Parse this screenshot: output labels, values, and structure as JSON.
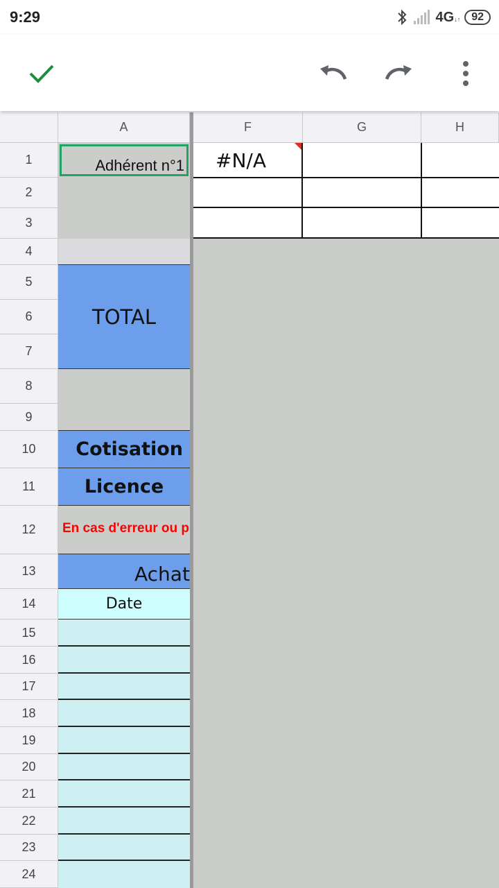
{
  "status_bar": {
    "time": "9:29",
    "network": "4G",
    "battery": "92",
    "icons": [
      "bluetooth-icon",
      "signal-icon",
      "battery-icon"
    ]
  },
  "toolbar": {
    "icons": [
      "check-icon",
      "undo-icon",
      "redo-icon",
      "more-vert-icon"
    ],
    "accent_color": "#1e8e3e"
  },
  "sheet": {
    "columns": [
      "A",
      "F",
      "G",
      "H"
    ],
    "rows": [
      "1",
      "2",
      "3",
      "4",
      "5",
      "6",
      "7",
      "8",
      "9",
      "10",
      "11",
      "12",
      "13",
      "14",
      "15",
      "16",
      "17",
      "18",
      "19",
      "20",
      "21",
      "22",
      "23",
      "24"
    ],
    "cells": {
      "A1": "Adhérent n°1",
      "F1": "#N/A",
      "A5": "TOTAL",
      "A10": "Cotisation",
      "A11": "Licence",
      "A12": "En cas d'erreur ou p",
      "A13": "Achat",
      "A14": "Date"
    },
    "colors": {
      "blue_fill": "#6d9eeb",
      "cyan_fill": "#cef0f2",
      "grey_fill": "#cbcdca",
      "error_text": "#ff0000",
      "selection": "#21a366"
    }
  }
}
